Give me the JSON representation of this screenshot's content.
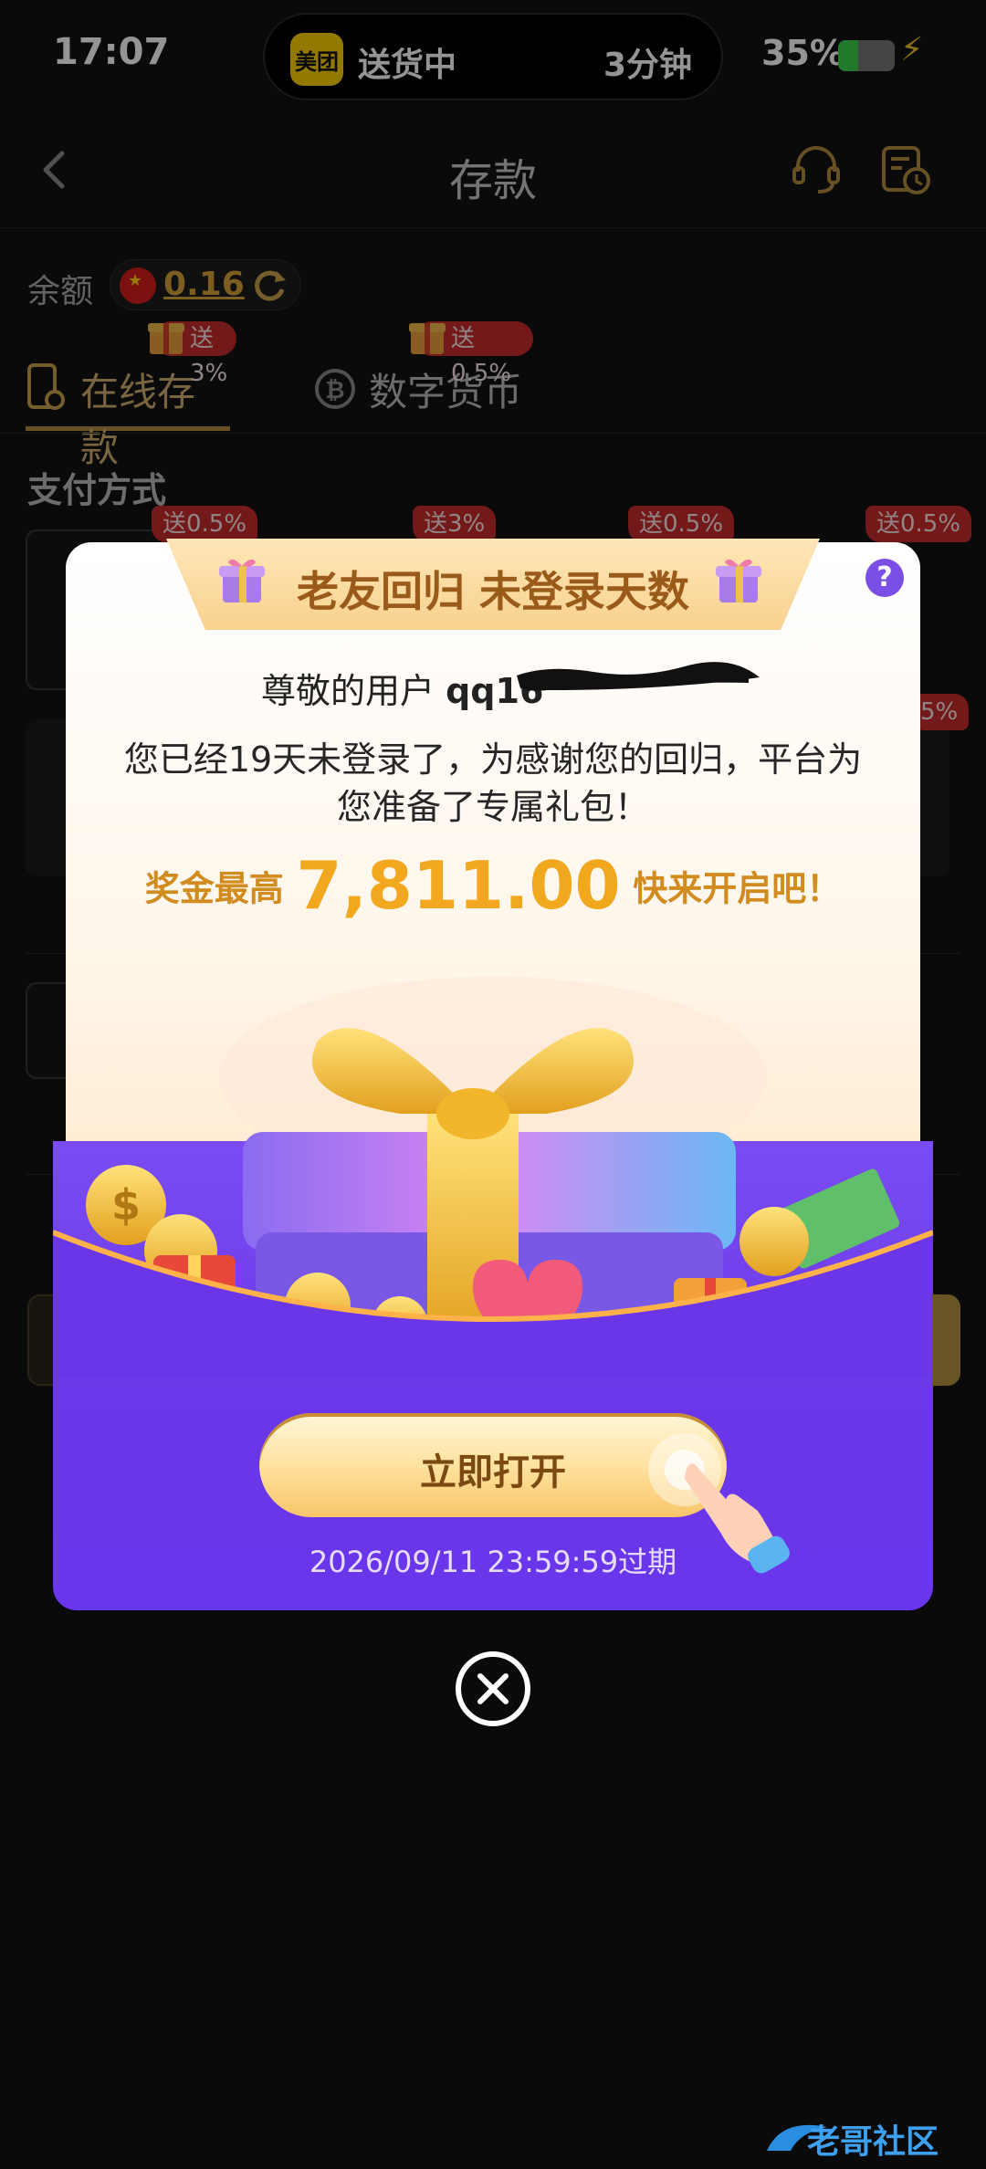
{
  "status_bar": {
    "time": "17:07",
    "island_app": "美团",
    "island_status": "送货中",
    "island_eta": "3分钟",
    "battery_percent": "35%",
    "battery_level": 0.35
  },
  "header": {
    "title": "存款"
  },
  "balance": {
    "label": "余额",
    "value": "0.16"
  },
  "tabs": [
    {
      "label": "在线存款",
      "badge": "送3%",
      "active": true
    },
    {
      "label": "数字货币",
      "badge": "送0.5%",
      "active": false
    }
  ],
  "section": {
    "title": "支付方式"
  },
  "background_badges": [
    "送0.5%",
    "送3%",
    "送0.5%",
    "送0.5%",
    "5%"
  ],
  "modal": {
    "banner_title": "老友回归 未登录天数",
    "help": "?",
    "greeting_prefix": "尊敬的用户",
    "username_visible": "qq16",
    "message": "您已经19天未登录了，为感谢您的回归，平台为您准备了专属礼包！",
    "reward_prefix": "奖金最高",
    "reward_amount": "7,811.00",
    "reward_suffix": "快来开启吧！",
    "open_button": "立即打开",
    "expiry": "2026/09/11 23:59:59过期"
  },
  "watermark": "老哥社区",
  "colors": {
    "accent_gold": "#d8a23a",
    "modal_purple": "#6a36e8",
    "badge_red": "#c92b2b"
  }
}
